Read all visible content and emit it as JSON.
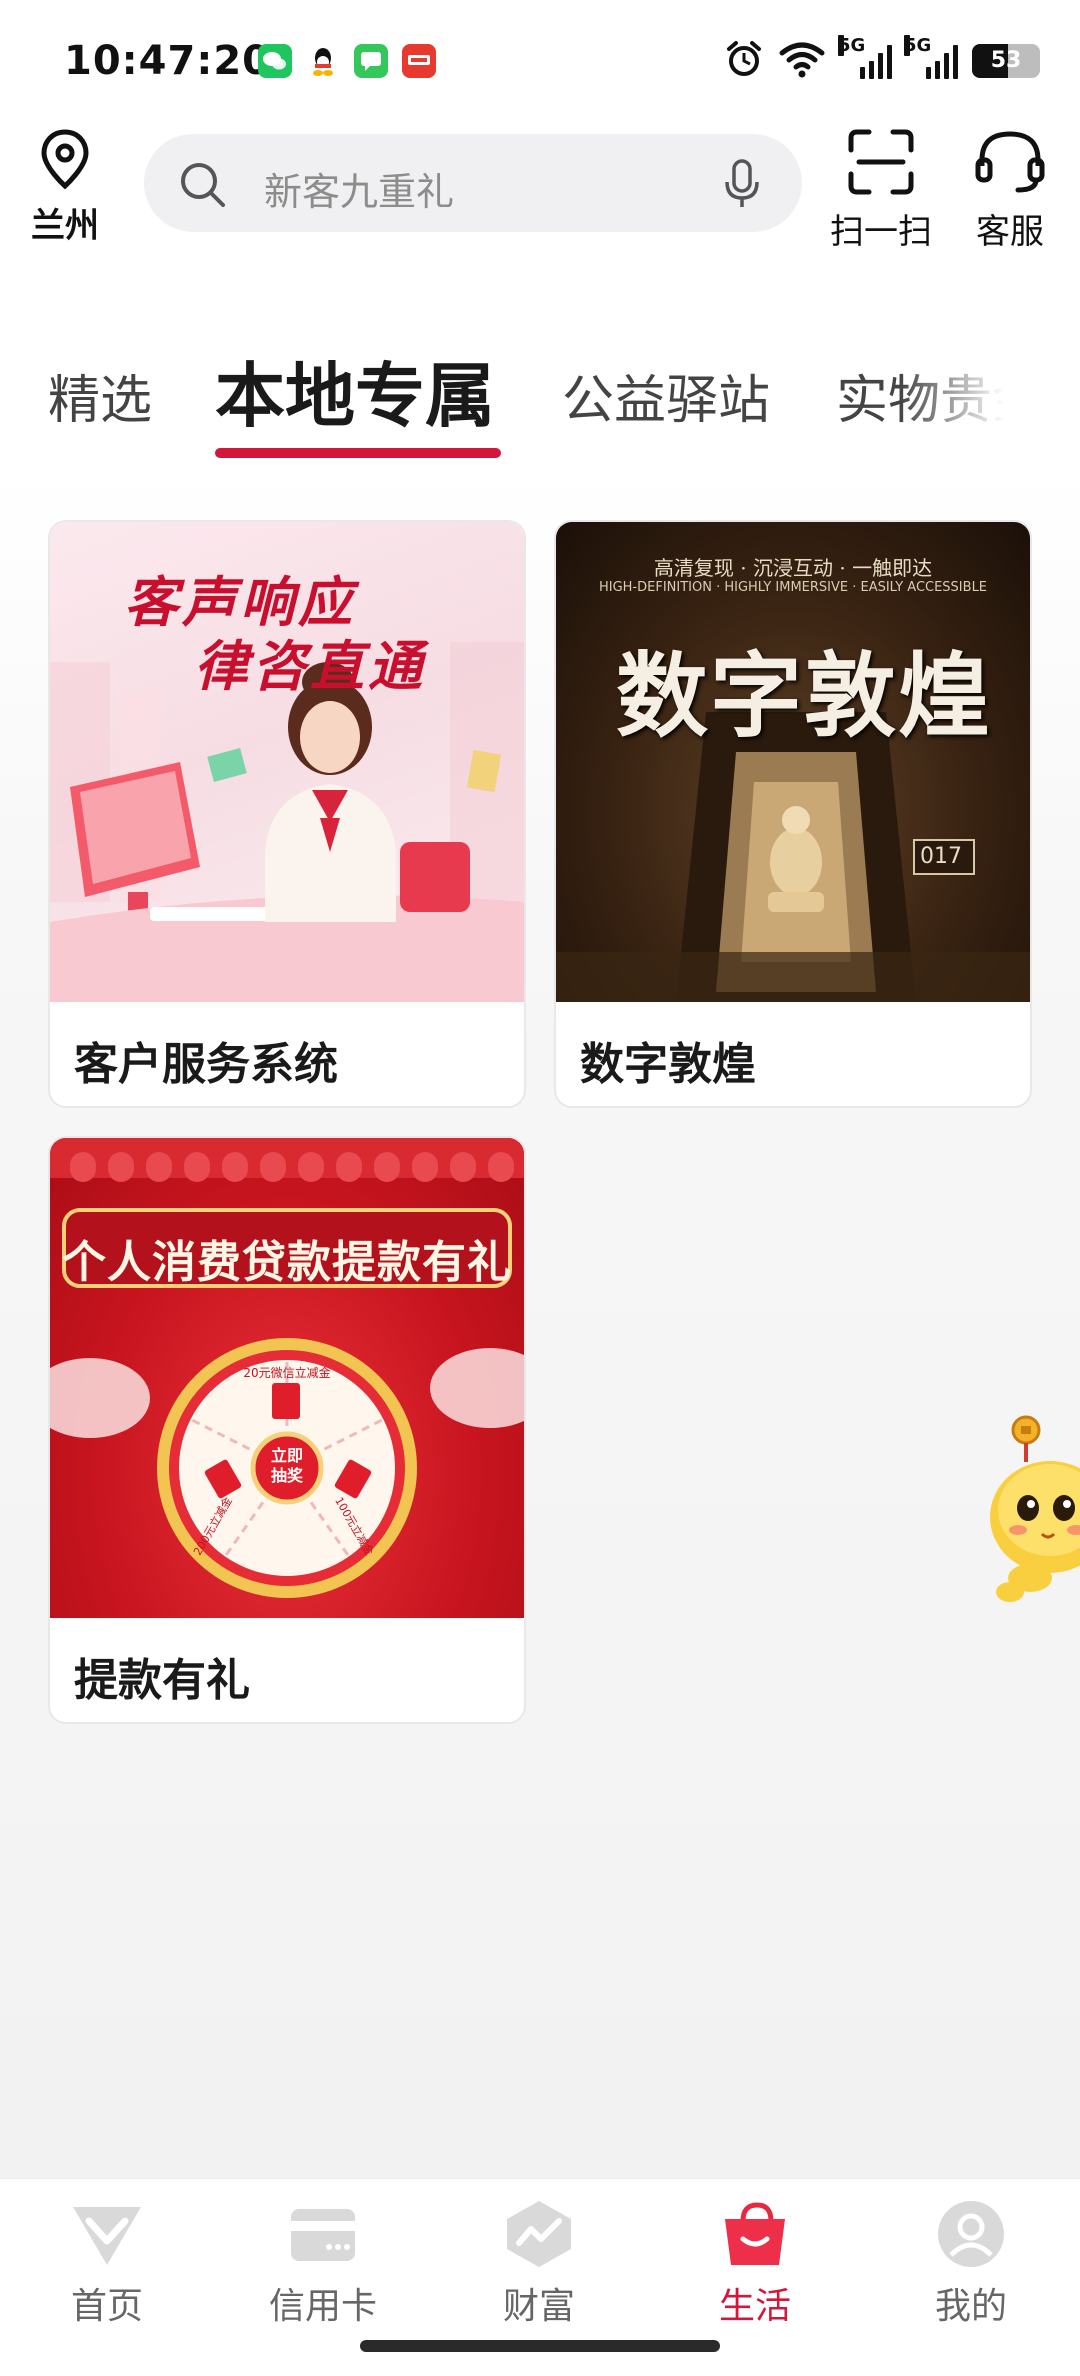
{
  "status_bar": {
    "time": "10:47:20",
    "battery": "53",
    "network": "5G"
  },
  "header": {
    "location": "兰州",
    "search_placeholder": "新客九重礼",
    "scan_label": "扫一扫",
    "service_label": "客服"
  },
  "tabs": [
    {
      "label": "精选",
      "active": false
    },
    {
      "label": "本地专属",
      "active": true
    },
    {
      "label": "公益驿站",
      "active": false
    },
    {
      "label": "实物贵金",
      "active": false
    }
  ],
  "cards": [
    {
      "title": "客户服务系统",
      "banner_line1": "客声响应",
      "banner_line2": "律咨直通"
    },
    {
      "title": "数字敦煌",
      "banner_top": "高清复现 · 沉浸互动 · 一触即达",
      "banner_sub": "HIGH-DEFINITION · HIGHLY IMMERSIVE · EASILY ACCESSIBLE",
      "banner_main": "数字敦煌",
      "banner_cave": "017"
    },
    {
      "title": "提款有礼",
      "banner_main": "个人消费贷款提款有礼",
      "wheel_top": "20元微信立减金",
      "wheel_center": "立即抽奖",
      "wheel_left": "200元立减金",
      "wheel_right": "100元立减金"
    }
  ],
  "bottom_nav": [
    {
      "label": "首页",
      "icon": "home-diamond-icon",
      "active": false
    },
    {
      "label": "信用卡",
      "icon": "credit-card-icon",
      "active": false
    },
    {
      "label": "财富",
      "icon": "wealth-chart-icon",
      "active": false
    },
    {
      "label": "生活",
      "icon": "shopping-bag-icon",
      "active": true
    },
    {
      "label": "我的",
      "icon": "profile-icon",
      "active": false
    }
  ],
  "colors": {
    "accent": "#d3173a",
    "inactive": "#666666"
  }
}
